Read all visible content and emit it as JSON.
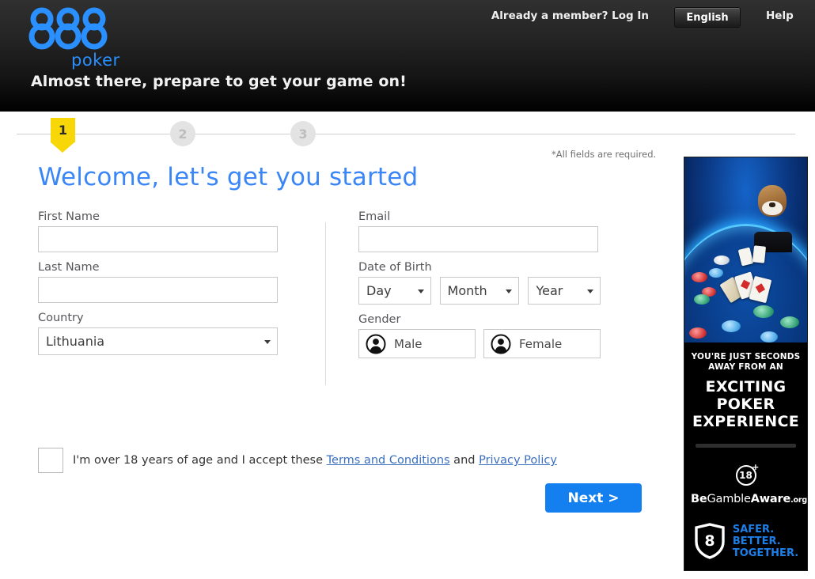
{
  "header": {
    "logo_text": "888",
    "logo_sub": "poker",
    "tagline": "Almost there, prepare to get your game on!",
    "login_link": "Already a member? Log In",
    "language_button": "English",
    "help_link": "Help"
  },
  "stepper": {
    "steps": [
      {
        "number": "1",
        "state": "active"
      },
      {
        "number": "2",
        "state": "inactive"
      },
      {
        "number": "3",
        "state": "inactive"
      }
    ],
    "active_color": "#f7d708",
    "inactive_color": "#e3e3e3"
  },
  "main": {
    "required_note": "*All fields are required.",
    "heading": "Welcome, let's get you started",
    "heading_color": "#3a86f7",
    "left_fields": [
      {
        "label": "First Name",
        "type": "text",
        "value": "",
        "placeholder": ""
      },
      {
        "label": "Last Name",
        "type": "text",
        "value": "",
        "placeholder": ""
      },
      {
        "label": "Country",
        "type": "select",
        "value": "Lithuania"
      }
    ],
    "email": {
      "label": "Email",
      "value": "",
      "placeholder": ""
    },
    "dob": {
      "label": "Date of Birth",
      "day": "Day",
      "month": "Month",
      "year": "Year"
    },
    "gender": {
      "label": "Gender",
      "options": [
        {
          "label": "Male",
          "icon": "person-icon"
        },
        {
          "label": "Female",
          "icon": "person-icon"
        }
      ]
    },
    "terms": {
      "checked": false,
      "text_before": "I'm over 18 years of age and I accept these ",
      "link_terms": "Terms and Conditions",
      "text_between": " and ",
      "link_privacy": "Privacy Policy"
    },
    "next_button": {
      "label": "Next >",
      "color": "#1480f0"
    }
  },
  "banner": {
    "subtitle_line1": "YOU'RE JUST SECONDS",
    "subtitle_line2": "AWAY FROM AN",
    "main_line1": "EXCITING",
    "main_line2": "POKER",
    "main_line3": "EXPERIENCE",
    "age_badge": "18",
    "age_badge_plus": "+",
    "gamble_aware_be": "Be",
    "gamble_aware_gamble": "Gamble",
    "gamble_aware_aware": "Aware",
    "gamble_aware_org": ".org",
    "gamble_aware_reg": "®",
    "shield_number": "8",
    "safer": "SAFER.",
    "better": "BETTER.",
    "together": "TOGETHER.",
    "accent_color": "#1d7fe8"
  }
}
